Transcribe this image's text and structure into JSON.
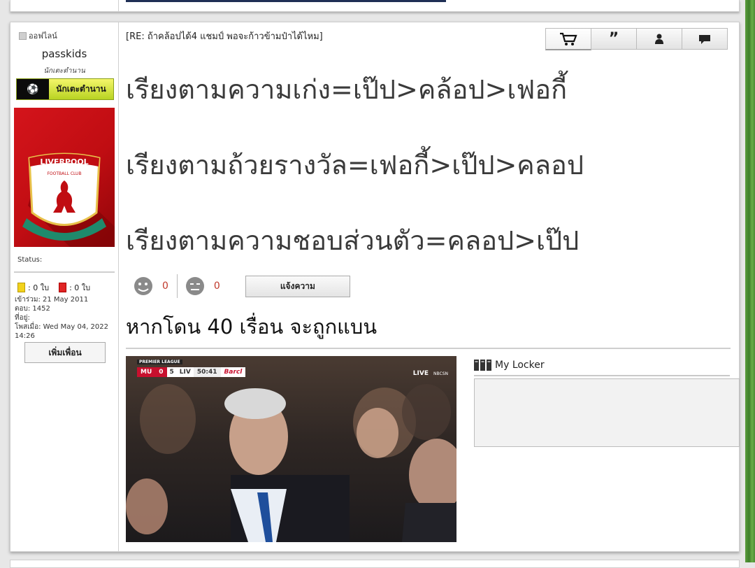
{
  "sidebar": {
    "online_label": "ออฟไลน์",
    "username": "passkids",
    "rank_title": "นักเตะตำนาน",
    "rank_badge": "นักเตะตำนาน",
    "avatar_text": {
      "line1": "LIVERPOOL",
      "line2": "FOOTBALL CLUB"
    },
    "status_label": "Status:",
    "yellow_cards": ": 0 ใบ",
    "red_cards": ": 0 ใบ",
    "joined": "เข้าร่วม: 21 May 2011",
    "replies": "ตอบ: 1452",
    "location": "ที่อยู่:",
    "posted": "โพสเมื่อ: Wed May 04, 2022 14:26",
    "add_friend": "เพิ่มเพื่อน"
  },
  "post": {
    "title": "[RE: ถ้าคล้อปได้4 แชมป์ พอจะก้าวข้ามป๋าได้ไหม]",
    "lines": [
      "เรียงตามความเก่ง=เป๊ป>คล้อป>เฟอกี้",
      "เรียงตามถ้วยรางวัล=เฟอกี้>เป๊ป>คลอป",
      "เรียงตามความชอบส่วนตัว=คลอป>เป๊ป"
    ],
    "likes": "0",
    "dislikes": "0",
    "report": "แจ้งความ",
    "signature": "หากโดน 40 เรื่อน จะถูกแบน"
  },
  "toolbar": {
    "icons": [
      "cart-icon",
      "quote-icon",
      "user-icon",
      "message-icon"
    ]
  },
  "photo": {
    "league": "PREMIER LEAGUE",
    "home": "MU",
    "home_score": "0",
    "away_score": "5",
    "away": "LIV",
    "clock": "50:41",
    "sponsor": "Barcl",
    "live": "LIVE",
    "network": "NBCSN"
  },
  "locker": {
    "title": "My Locker"
  }
}
